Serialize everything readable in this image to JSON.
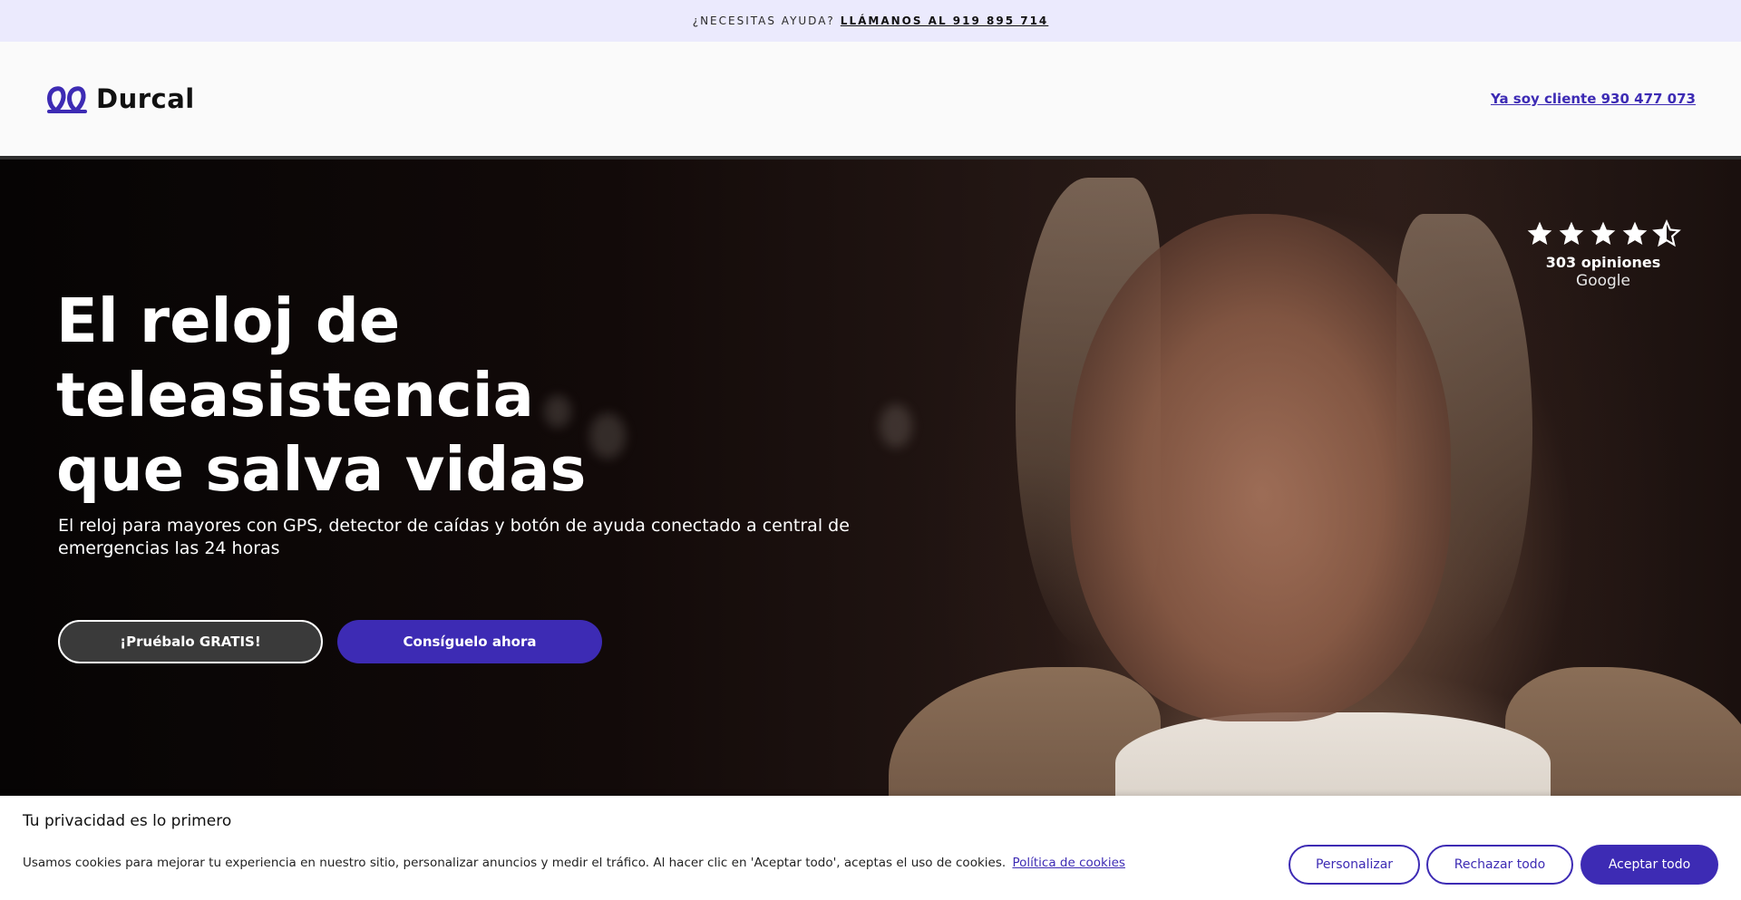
{
  "topbar": {
    "question": "¿NECESITAS AYUDA?",
    "call_link": "LLÁMANOS AL 919 895 714"
  },
  "header": {
    "brand": "Durcal",
    "client_link": "Ya soy cliente 930 477 073"
  },
  "hero": {
    "title_line1": "El reloj de",
    "title_line2": "teleasistencia",
    "title_line3": "que salva vidas",
    "subtitle": "El reloj para mayores con GPS, detector de caídas y botón de ayuda conectado a central de emergencias las 24 horas",
    "try_button": "¡Pruébalo GRATIS!",
    "get_button": "Consíguelo ahora",
    "rating": {
      "stars": 4.5,
      "count_label": "303 opiniones",
      "source": "Google"
    }
  },
  "cookie_banner": {
    "title": "Tu privacidad es lo primero",
    "text": "Usamos cookies para mejorar tu experiencia en nuestro sitio, personalizar anuncios y medir el tráfico. Al hacer clic en 'Aceptar todo', aceptas el uso de cookies.",
    "policy_link": "Política de cookies",
    "customize_button": "Personalizar",
    "reject_button": "Rechazar todo",
    "accept_button": "Aceptar todo"
  },
  "colors": {
    "brand": "#3d2bb4",
    "topbar_bg": "#ebeafd"
  },
  "icons": [
    "durcal-logo-icon",
    "star-icon",
    "star-half-icon"
  ]
}
